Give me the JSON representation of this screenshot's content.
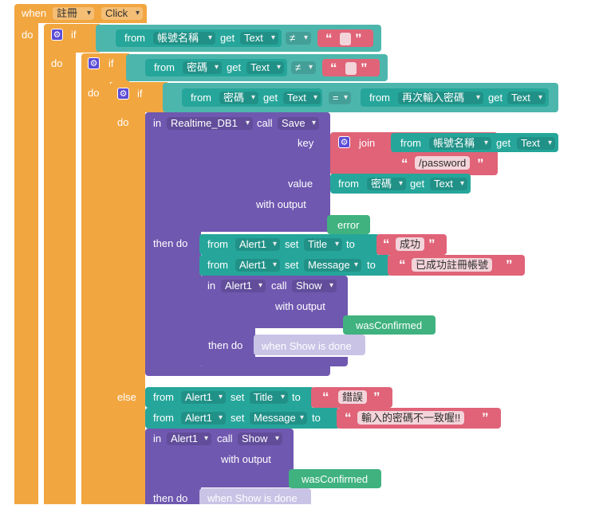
{
  "event": {
    "when": "when",
    "component": "註冊",
    "event_name": "Click",
    "do": "do"
  },
  "if1": {
    "if": "if",
    "do": "do",
    "from": "from",
    "component": "帳號名稱",
    "get": "get",
    "prop": "Text",
    "op": "≠"
  },
  "if2": {
    "if": "if",
    "do": "do",
    "from": "from",
    "component": "密碼",
    "get": "get",
    "prop": "Text",
    "op": "≠"
  },
  "if3": {
    "if": "if",
    "do": "do",
    "from": "from",
    "left_component": "密碼",
    "get": "get",
    "prop": "Text",
    "op": "=",
    "right_component": "再次輸入密碼",
    "right_prop": "Text"
  },
  "save_call": {
    "in": "in",
    "component": "Realtime_DB1",
    "call": "call",
    "method": "Save",
    "key_label": "key",
    "join": "join",
    "from": "from",
    "join_component": "帳號名稱",
    "get": "get",
    "join_prop": "Text",
    "password_suffix": "/password",
    "value_label": "value",
    "value_component": "密碼",
    "value_prop": "Text",
    "with_output": "with output",
    "error": "error",
    "then_do": "then do"
  },
  "success": {
    "from": "from",
    "component": "Alert1",
    "set": "set",
    "to": "to",
    "title_prop": "Title",
    "title_value": "成功",
    "message_prop": "Message",
    "message_value": "已成功註冊帳號",
    "in": "in",
    "call": "call",
    "method": "Show",
    "with_output": "with output",
    "was_confirmed": "wasConfirmed",
    "then_do": "then do",
    "placeholder": "when Show is done"
  },
  "else_branch": {
    "else": "else",
    "from": "from",
    "component": "Alert1",
    "set": "set",
    "to": "to",
    "title_prop": "Title",
    "title_value": "錯誤",
    "message_prop": "Message",
    "message_value": "輸入的密碼不一致喔!!",
    "in": "in",
    "call": "call",
    "method": "Show",
    "with_output": "with output",
    "was_confirmed": "wasConfirmed",
    "then_do": "then do",
    "placeholder": "when Show is done"
  },
  "quote_open": "“",
  "quote_close": "”",
  "gear_glyph": "⚙",
  "colors": {
    "event": "#f2a640",
    "text": "#4db6ac",
    "component": "#26a69a",
    "procedure": "#6f58b0",
    "string": "#e06378",
    "control": "#f2a640"
  }
}
